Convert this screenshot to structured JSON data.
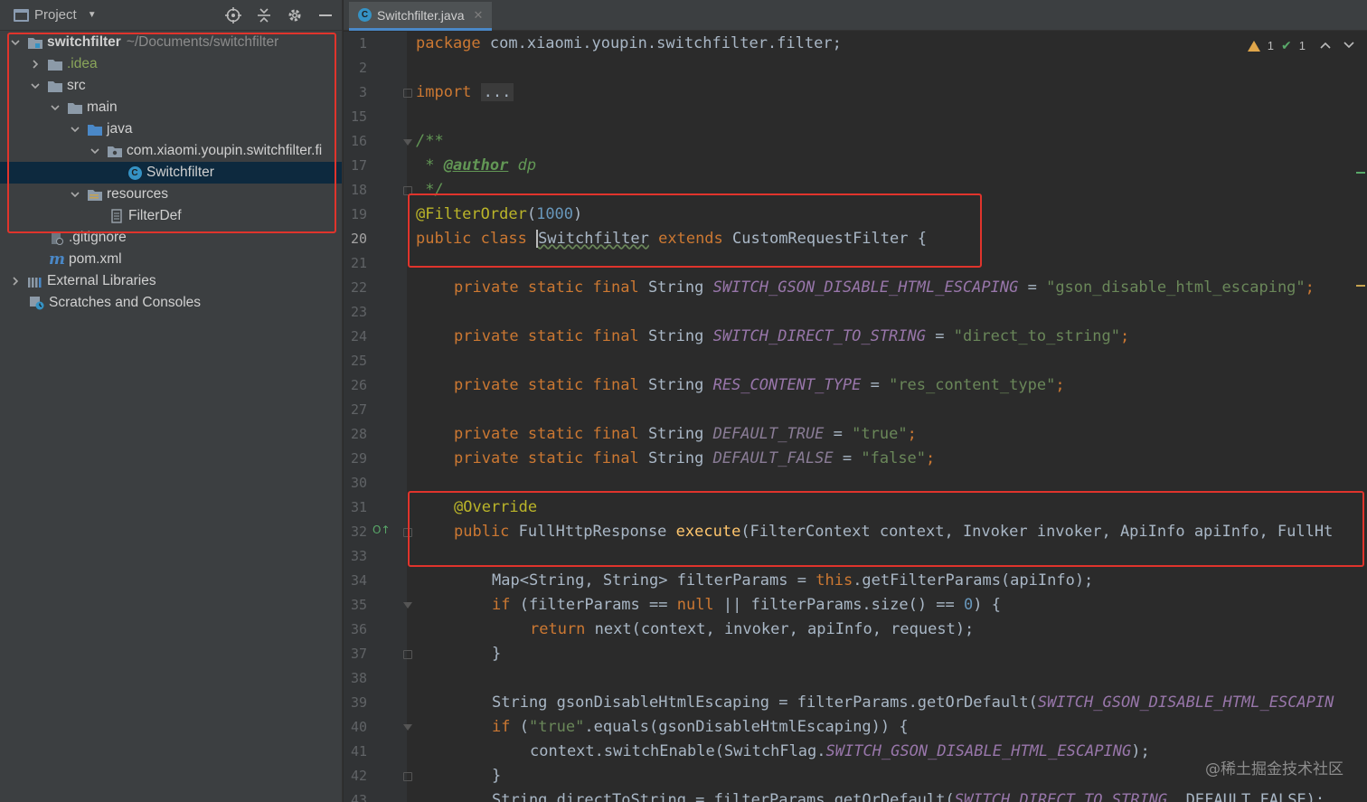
{
  "project_panel": {
    "title": "Project",
    "tree": [
      {
        "label": "switchfilter",
        "path": "~/Documents/switchfilter",
        "icon": "module-folder-icon",
        "expanded": true
      },
      {
        "label": ".idea",
        "icon": "folder-icon",
        "expanded": false
      },
      {
        "label": "src",
        "icon": "folder-icon",
        "expanded": true
      },
      {
        "label": "main",
        "icon": "folder-icon",
        "expanded": true
      },
      {
        "label": "java",
        "icon": "source-folder-icon",
        "expanded": true
      },
      {
        "label": "com.xiaomi.youpin.switchfilter.fi",
        "icon": "package-icon",
        "expanded": true
      },
      {
        "label": "Switchfilter",
        "icon": "class-icon",
        "selected": true
      },
      {
        "label": "resources",
        "icon": "resources-folder-icon",
        "expanded": true
      },
      {
        "label": "FilterDef",
        "icon": "file-icon"
      },
      {
        "label": ".gitignore",
        "icon": "gitignore-icon"
      },
      {
        "label": "pom.xml",
        "icon": "maven-icon"
      },
      {
        "label": "External Libraries",
        "icon": "library-icon",
        "expanded": false
      },
      {
        "label": "Scratches and Consoles",
        "icon": "scratches-icon"
      }
    ]
  },
  "editor": {
    "tab_label": "Switchfilter.java",
    "inspection": {
      "warnings": "1",
      "ok": "1"
    },
    "line_numbers": [
      "1",
      "2",
      "3",
      "15",
      "16",
      "17",
      "18",
      "19",
      "20",
      "21",
      "22",
      "23",
      "24",
      "25",
      "26",
      "27",
      "28",
      "29",
      "30",
      "31",
      "32",
      "33",
      "34",
      "35",
      "36",
      "37",
      "38",
      "39",
      "40",
      "41",
      "42",
      "43"
    ],
    "current_line": "20"
  },
  "code": {
    "l1_kw": "package",
    "l1_rest": " com.xiaomi.youpin.switchfilter.filter;",
    "l3_kw": "import",
    "l3_fold": "...",
    "l16": "/**",
    "l17_star": " * ",
    "l17_tag": "@author",
    "l17_rest": " dp",
    "l18": " */",
    "l19_ann": "@FilterOrder",
    "l19_open": "(",
    "l19_num": "1000",
    "l19_close": ")",
    "l20_kw1": "public class ",
    "l20_cls": "Switchfilter",
    "l20_kw2": " extends ",
    "l20_rest": "CustomRequestFilter {",
    "pkw": "private static final ",
    "type_string": "String ",
    "eq": " = ",
    "semi": ";",
    "c1_name": "SWITCH_GSON_DISABLE_HTML_ESCAPING",
    "c1_val": "\"gson_disable_html_escaping\"",
    "c2_name": "SWITCH_DIRECT_TO_STRING",
    "c2_val": "\"direct_to_string\"",
    "c3_name": "RES_CONTENT_TYPE",
    "c3_val": "\"res_content_type\"",
    "c4_name": "DEFAULT_TRUE",
    "c4_val": "\"true\"",
    "c5_name": "DEFAULT_FALSE",
    "c5_val": "\"false\"",
    "l31_ann": "@Override",
    "l32_kw": "public ",
    "l32_type": "FullHttpResponse ",
    "l32_mth": "execute",
    "l32_rest": "(FilterContext context, Invoker invoker, ApiInfo apiInfo, FullHt",
    "l34_a": "Map<String, String> filterParams = ",
    "l34_this": "this",
    "l34_b": ".getFilterParams(apiInfo);",
    "l35_if": "if ",
    "l35_a": "(filterParams == ",
    "l35_null": "null",
    "l35_b": " || filterParams.size() == ",
    "l35_num": "0",
    "l35_c": ") {",
    "l36_ret": "return ",
    "l36_rest": "next(context, invoker, apiInfo, request);",
    "l37": "}",
    "l39_a": "String gsonDisableHtmlEscaping = filterParams.getOrDefault(",
    "l39_cst": "SWITCH_GSON_DISABLE_HTML_ESCAPIN",
    "l40_if": "if ",
    "l40_open": "(",
    "l40_str": "\"true\"",
    "l40_rest": ".equals(gsonDisableHtmlEscaping)) {",
    "l41_a": "context.switchEnable(SwitchFlag.",
    "l41_cst": "SWITCH_GSON_DISABLE_HTML_ESCAPING",
    "l41_b": ");",
    "l42": "}",
    "l43_a": "String directToString = filterParams.getOrDefault(",
    "l43_cst": "SWITCH_DIRECT_TO_STRING",
    "l43_b": ", DEFAULT_FALSE);"
  },
  "colors": {
    "highlight_box": "#e0342c",
    "selection": "#0d293e",
    "accent": "#4a88c7"
  },
  "watermark": "@稀土掘金技术社区"
}
